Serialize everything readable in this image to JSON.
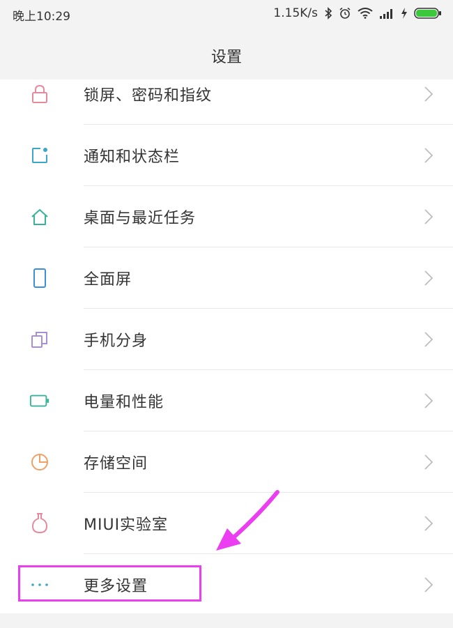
{
  "status_bar": {
    "time": "晚上10:29",
    "network_speed": "1.15K/s",
    "icons": [
      "bluetooth-icon",
      "alarm-icon",
      "wifi-icon",
      "signal-icon",
      "charging-icon",
      "battery-icon"
    ],
    "battery_color": "#3cc83c"
  },
  "header": {
    "title": "设置"
  },
  "settings": {
    "items": [
      {
        "label": "锁屏、密码和指纹",
        "icon": "lock-icon",
        "color": "#e58a9c"
      },
      {
        "label": "通知和状态栏",
        "icon": "notification-icon",
        "color": "#3aa7c9"
      },
      {
        "label": "桌面与最近任务",
        "icon": "home-icon",
        "color": "#36b39a"
      },
      {
        "label": "全面屏",
        "icon": "phone-screen-icon",
        "color": "#3b8fd6"
      },
      {
        "label": "手机分身",
        "icon": "dual-space-icon",
        "color": "#a78fd8"
      },
      {
        "label": "电量和性能",
        "icon": "battery-outline-icon",
        "color": "#36b39a"
      },
      {
        "label": "存储空间",
        "icon": "pie-chart-icon",
        "color": "#f0a064"
      },
      {
        "label": "MIUI实验室",
        "icon": "flask-icon",
        "color": "#e58a9c"
      },
      {
        "label": "更多设置",
        "icon": "more-dots-icon",
        "color": "#3aa7c9"
      }
    ]
  },
  "annotation": {
    "highlight_color": "#ea3ef0",
    "highlighted_item": "更多设置"
  }
}
